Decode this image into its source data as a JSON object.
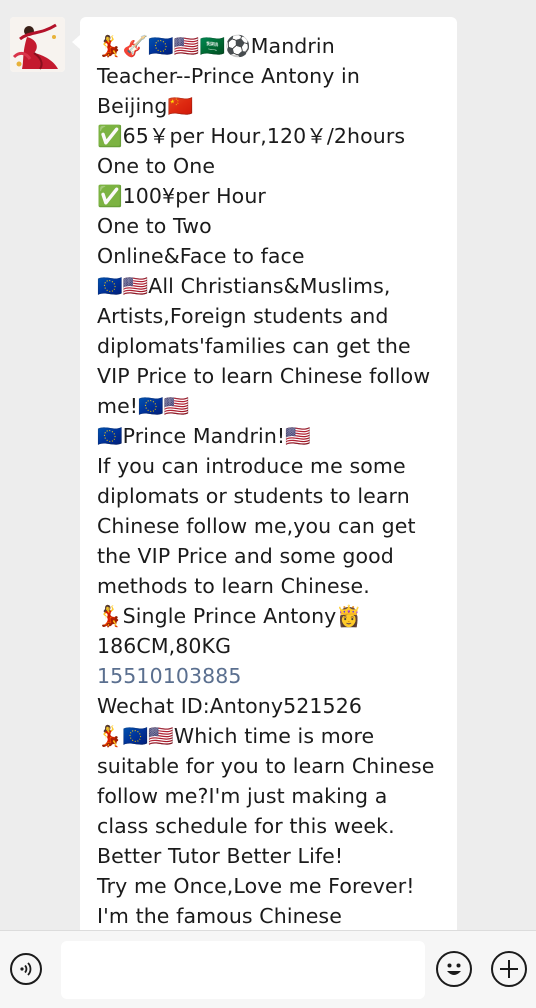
{
  "message": {
    "lines": [
      "💃🎸🇪🇺🇺🇸🇸🇦⚽Mandrin",
      "Teacher--Prince Antony in",
      "Beijing🇨🇳",
      "✅65￥per Hour,120￥/2hours",
      " One to One",
      "✅100¥per Hour",
      "One to Two",
      "Online&Face to face",
      "🇪🇺🇺🇸All Christians&Muslims,",
      "Artists,Foreign students and",
      "diplomats'families can get the",
      "VIP Price to learn Chinese follow",
      "me!🇪🇺🇺🇸",
      "🇪🇺Prince Mandrin!🇺🇸",
      "If you can introduce me some",
      "diplomats or students to learn",
      "Chinese follow me,you can get",
      "the VIP Price and some good",
      "methods to learn Chinese.",
      "💃Single Prince Antony👸",
      "186CM,80KG",
      "15510103885",
      "Wechat ID:Antony521526",
      "💃🇪🇺🇺🇸Which time is more",
      "suitable for you to learn Chinese",
      "follow me?I'm just making a",
      "class schedule for this week.",
      "Better Tutor Better Life!",
      "Try me Once,Love me Forever!",
      "I'm the famous Chinese"
    ],
    "phone_line_index": 21
  },
  "input_bar": {
    "voice_icon": "voice-icon",
    "emoji_icon": "emoji-icon",
    "plus_icon": "plus-icon"
  },
  "colors": {
    "background": "#ededed",
    "bubble": "#ffffff",
    "phone_link": "#5a6f8f"
  }
}
